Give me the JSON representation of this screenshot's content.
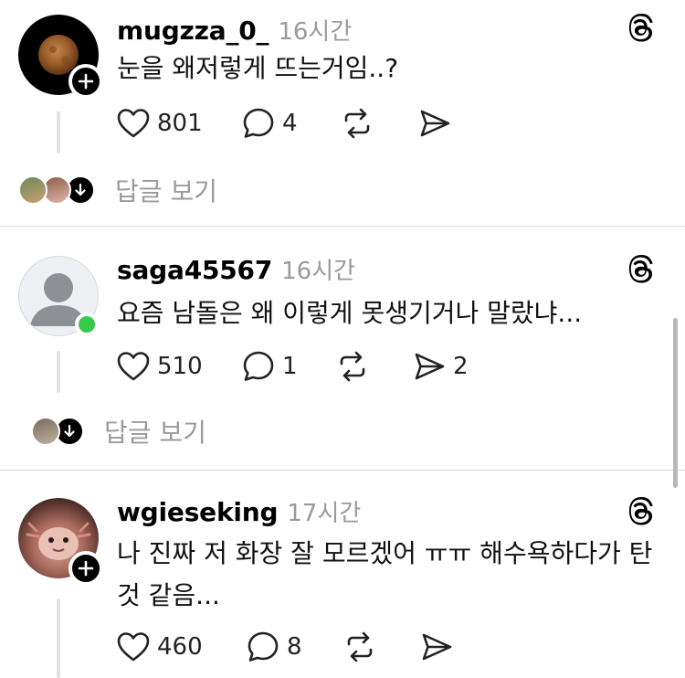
{
  "posts": [
    {
      "username": "mugzza_0_",
      "time": "16시간",
      "text": "눈을 왜저렇게 뜨는거임..?",
      "likes": "801",
      "comments": "4",
      "shares": "",
      "reply_label": "답글 보기",
      "avatar_icon": "moon-photo-avatar"
    },
    {
      "username": "saga45567",
      "time": "16시간",
      "text": "요즘 남돌은 왜 이렇게 못생기거나 말랐냐...",
      "likes": "510",
      "comments": "1",
      "shares": "2",
      "reply_label": "답글 보기",
      "avatar_icon": "default-person-avatar"
    },
    {
      "username": "wgieseking",
      "time": "17시간",
      "text_line1": "나 진짜 저 화장 잘 모르겠어 ㅠㅠ 해수욕하다가 탄",
      "text_line2": "것 같음...",
      "likes": "460",
      "comments": "8",
      "shares": "",
      "avatar_icon": "axolotl-photo-avatar"
    }
  ],
  "colors": {
    "online": "#36c94a",
    "muted_text": "#9a9a9a",
    "divider": "#dcdcdc"
  }
}
